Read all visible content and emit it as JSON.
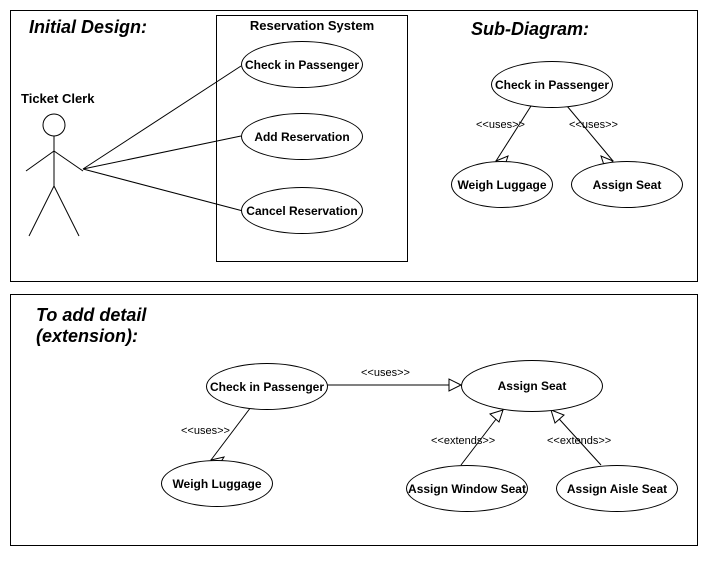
{
  "top": {
    "title_left": "Initial Design:",
    "title_right": "Sub-Diagram:",
    "actor_label": "Ticket Clerk",
    "system_title": "Reservation System",
    "uc_checkin": "Check in Passenger",
    "uc_addres": "Add Reservation",
    "uc_cancel": "Cancel Reservation",
    "sub_checkin": "Check in Passenger",
    "sub_weigh": "Weigh Luggage",
    "sub_assign": "Assign Seat",
    "sub_uses_left": "<<uses>>",
    "sub_uses_right": "<<uses>>"
  },
  "bottom": {
    "title": "To add detail (extension):",
    "uc_checkin": "Check in Passenger",
    "uc_weigh": "Weigh Luggage",
    "uc_assign": "Assign Seat",
    "uc_window": "Assign Window Seat",
    "uc_aisle": "Assign Aisle Seat",
    "uses_top": "<<uses>>",
    "uses_left": "<<uses>>",
    "extends_left": "<<extends>>",
    "extends_right": "<<extends>>"
  }
}
